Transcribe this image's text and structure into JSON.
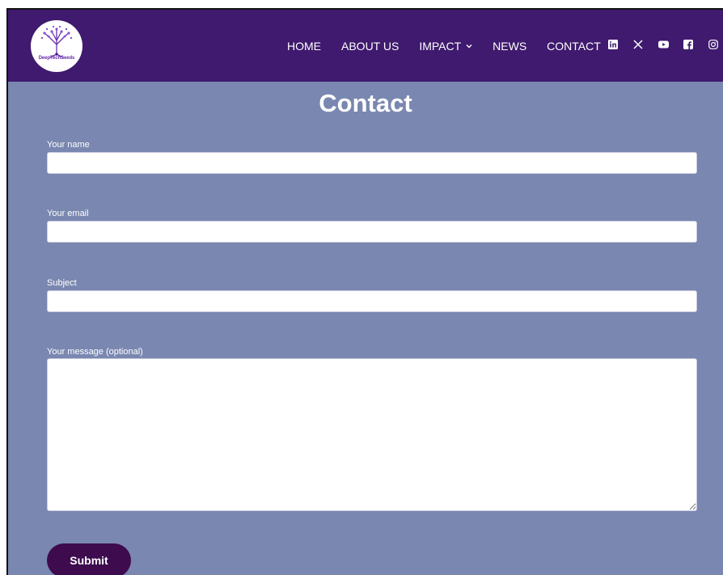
{
  "brand": {
    "logo_text": "DeepTechSeeds",
    "logo_color": "#6b2fb0"
  },
  "header": {
    "background": "#3f1a6e",
    "nav": [
      {
        "label": "HOME"
      },
      {
        "label": "ABOUT US"
      },
      {
        "label": "IMPACT"
      },
      {
        "label": "NEWS"
      },
      {
        "label": "CONTACT"
      }
    ],
    "socials": [
      "linkedin-icon",
      "x-icon",
      "youtube-icon",
      "facebook-icon",
      "instagram-icon"
    ]
  },
  "page": {
    "title": "Contact",
    "background": "#7a87b0"
  },
  "form": {
    "name_label": "Your name",
    "name_value": "",
    "email_label": "Your email",
    "email_value": "",
    "subject_label": "Subject",
    "subject_value": "",
    "message_label": "Your message (optional)",
    "message_value": "",
    "submit_label": "Submit",
    "submit_color": "#3d0b4e"
  }
}
